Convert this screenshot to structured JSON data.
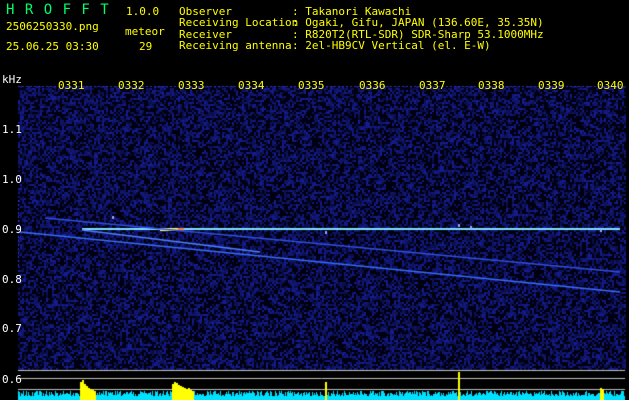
{
  "app": {
    "name": "H R O F F T",
    "version": "1.0.0",
    "filename": "2506250330.png",
    "datetime": "25.06.25 03:30",
    "meteor_label": "meteor",
    "meteor_count": "29"
  },
  "info": {
    "labels": [
      "Observer",
      "Receiving Location",
      "Receiver",
      "Receiving antenna"
    ],
    "values": [
      ": Takanori Kawachi",
      ": Ogaki, Gifu, JAPAN (136.60E, 35.35N)",
      ": R820T2(RTL-SDR) SDR-Sharp 53.1000MHz",
      ": 2el-HB9CV Vertical (el. E-W)"
    ]
  },
  "axis": {
    "unit": "kHz",
    "time_ticks": [
      "0331",
      "0332",
      "0333",
      "0334",
      "0335",
      "0336",
      "0337",
      "0338",
      "0339",
      "0340"
    ],
    "freq_ticks": [
      "1.1",
      "1.0",
      "0.9",
      "0.8",
      "0.7",
      "0.6"
    ]
  },
  "colors": {
    "background": "#000000",
    "text": "#ffffff",
    "accent": "#ffff00",
    "title": "#00ff66",
    "noise": "#141470",
    "signal": "#00ffff",
    "meteor_bar": "#ffff00"
  }
}
